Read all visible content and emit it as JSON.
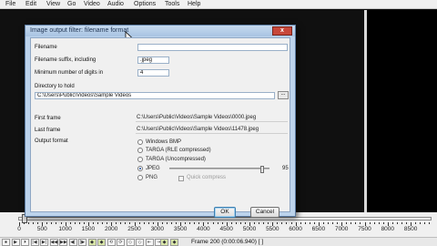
{
  "menu": [
    "File",
    "Edit",
    "View",
    "Go",
    "Video",
    "Audio",
    "Options",
    "Tools",
    "Help"
  ],
  "dialog": {
    "title": "Image output filter: filename format",
    "close_label": "x",
    "filename_label": "Filename",
    "filename_value": "",
    "suffix_label": "Filename suffix, including",
    "suffix_value": ".jpeg",
    "digits_label": "Minimum number of digits in",
    "digits_value": "4",
    "dir_label": "Directory to hold",
    "dir_value": "C:\\Users\\Public\\Videos\\Sample Videos",
    "browse_label": "...",
    "first_frame_label": "First frame",
    "first_frame_value": "C:\\Users\\Public\\Videos\\Sample Videos\\0000.jpeg",
    "last_frame_label": "Last frame",
    "last_frame_value": "C:\\Users\\Public\\Videos\\Sample Videos\\11478.jpeg",
    "output_format_label": "Output format",
    "formats": [
      "Windows BMP",
      "TARGA (RLE compressed)",
      "TARGA (Uncompressed)",
      "JPEG",
      "PNG"
    ],
    "selected_format": "JPEG",
    "quality_value": "95",
    "quality_fraction": 0.93,
    "quick_compress_label": "Quick compress",
    "ok_label": "OK",
    "cancel_label": "Cancel"
  },
  "timeline": {
    "ticks": [
      "0",
      "500",
      "1000",
      "1500",
      "2000",
      "2500",
      "3000",
      "3500",
      "4000",
      "4500",
      "5000",
      "5500",
      "6000",
      "6500",
      "7000",
      "7500",
      "8000",
      "8500"
    ]
  },
  "transport": {
    "buttons": [
      "⏹",
      "▶",
      "⏵",
      "|◀",
      "▶|",
      "◀◀",
      "▶▶",
      "◀|",
      "|▶",
      "◆",
      "◆",
      "⟲",
      "⟳",
      "◇",
      "◇",
      "⇤",
      "⇥",
      "◆",
      "◆"
    ],
    "frame_info": "Frame 200 (0:00:06.940) [ ]"
  },
  "colors": {
    "dialog_frame": "#bcd3ec",
    "close_button": "#c7473a",
    "ok_focus": "#3c7fb1"
  }
}
